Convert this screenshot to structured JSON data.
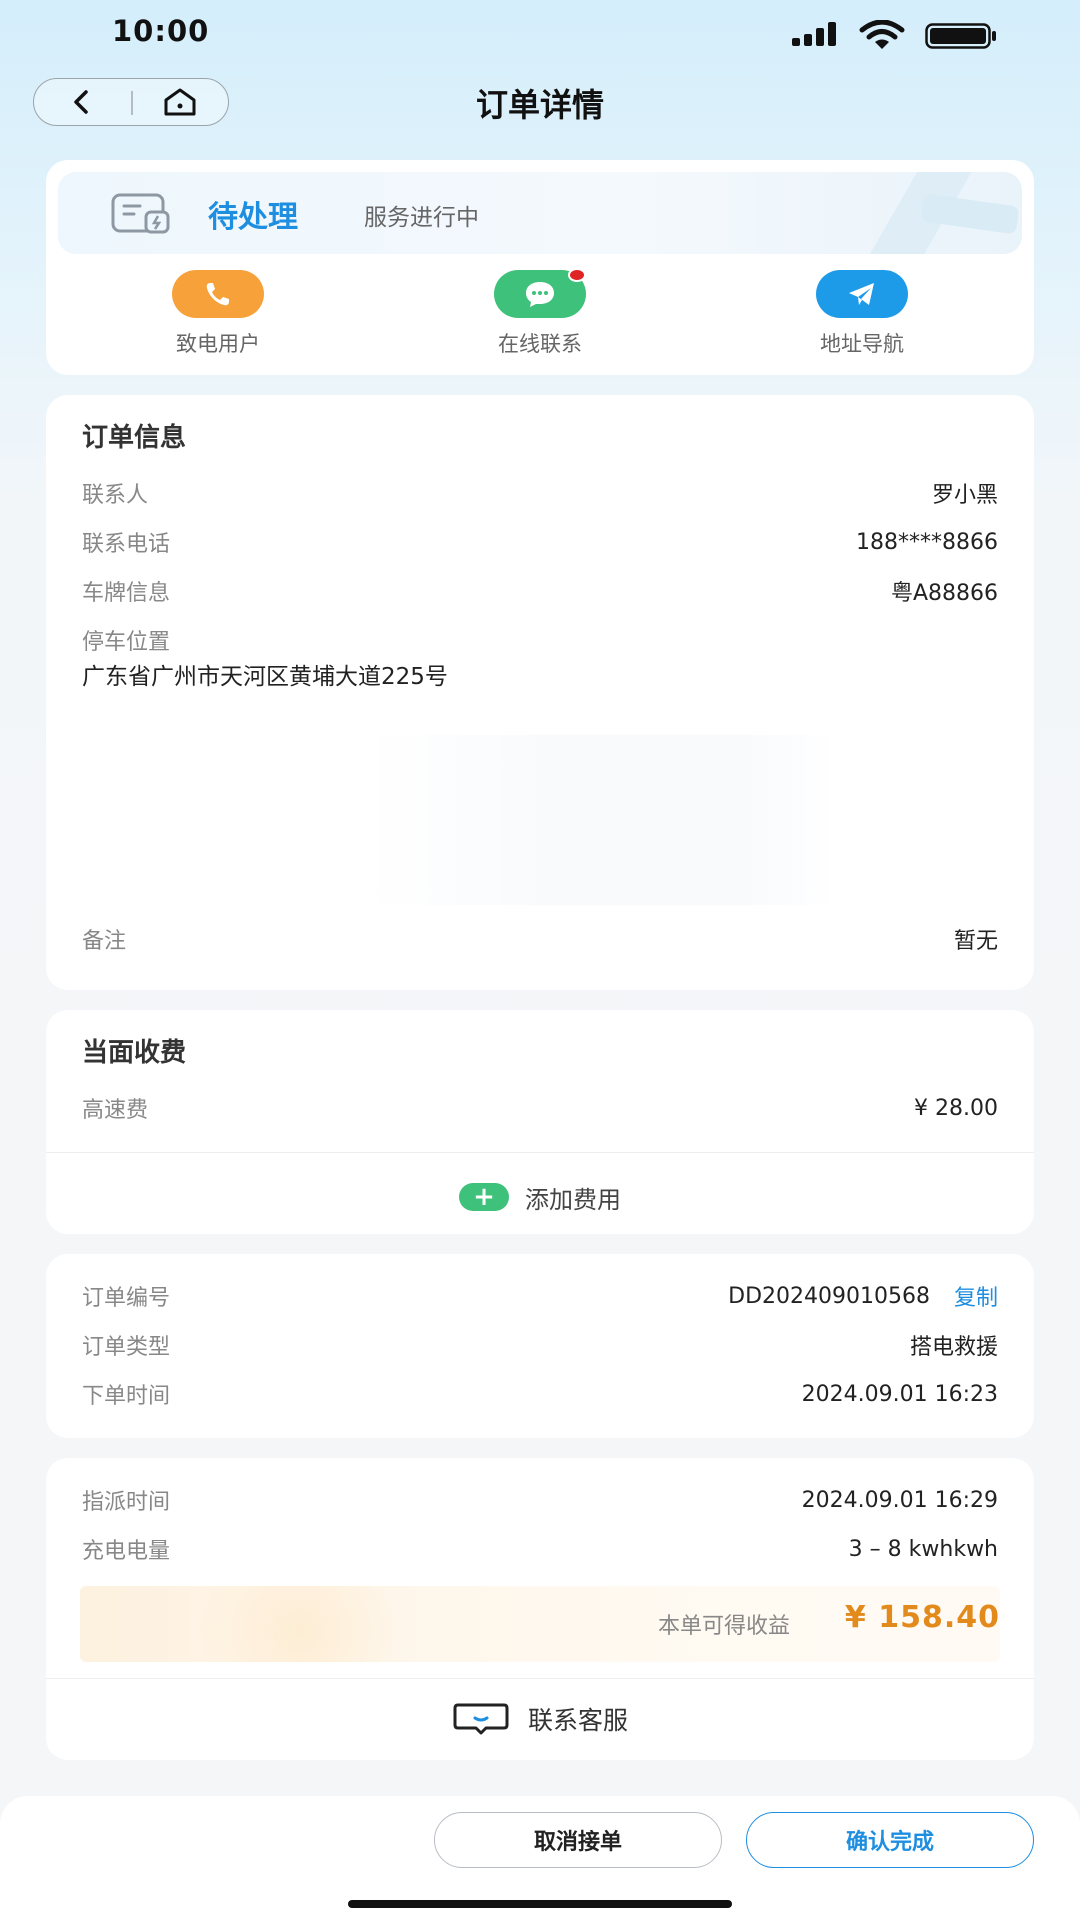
{
  "status_bar": {
    "time": "10:00"
  },
  "nav": {
    "title": "订单详情"
  },
  "status": {
    "main": "待处理",
    "sub": "服务进行中"
  },
  "actions": [
    {
      "label": "致电用户",
      "icon": "phone-icon",
      "color": "#f7a13a"
    },
    {
      "label": "在线联系",
      "icon": "chat-icon",
      "color": "#3ec17a",
      "has_badge": true
    },
    {
      "label": "地址导航",
      "icon": "send-icon",
      "color": "#1e9be8"
    }
  ],
  "order_info": {
    "title": "订单信息",
    "rows": [
      {
        "label": "联系人",
        "value": "罗小黑"
      },
      {
        "label": "联系电话",
        "value": "188****8866"
      },
      {
        "label": "车牌信息",
        "value": "粤A88866"
      },
      {
        "label": "停车位置",
        "value": ""
      }
    ],
    "address": "广东省广州市天河区黄埔大道225号",
    "remark_label": "备注",
    "remark_value": "暂无"
  },
  "fees": {
    "title": "当面收费",
    "items": [
      {
        "label": "高速费",
        "value": "¥ 28.00"
      }
    ],
    "add_label": "添加费用",
    "add_symbol": "+"
  },
  "order_meta": {
    "rows": [
      {
        "label": "订单编号",
        "value": "DD202409010568"
      },
      {
        "label": "订单类型",
        "value": "搭电救援"
      },
      {
        "label": "下单时间",
        "value": "2024.09.01 16:23"
      }
    ],
    "copy_label": "复制"
  },
  "dispatch": {
    "rows": [
      {
        "label": "指派时间",
        "value": "2024.09.01 16:29"
      },
      {
        "label": "充电电量",
        "value": "3 – 8 kwhkwh"
      }
    ],
    "earning_label": "本单可得收益",
    "earning_value": "¥ 158.40",
    "service_label": "联系客服"
  },
  "bottom": {
    "cancel_label": "取消接单",
    "confirm_label": "确认完成"
  },
  "colors": {
    "accent": "#1e8ee0",
    "earning": "#e38a1c",
    "call": "#f7a13a",
    "chat": "#3ec17a",
    "nav": "#1e9be8"
  }
}
